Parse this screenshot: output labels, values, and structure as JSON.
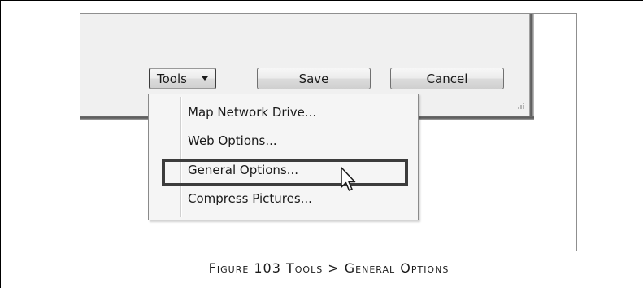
{
  "dialog": {
    "buttons": {
      "tools_label": "Tools",
      "save_label": "Save",
      "cancel_label": "Cancel"
    },
    "icons": {
      "dropdown": "chevron-down-icon",
      "resize": "resize-grip-icon",
      "cursor": "arrow-cursor-icon"
    }
  },
  "tools_menu": {
    "items": [
      {
        "label": "Map Network Drive..."
      },
      {
        "label": "Web Options..."
      },
      {
        "label": "General Options...",
        "highlighted": true
      },
      {
        "label": "Compress Pictures..."
      }
    ],
    "highlight_color": "#3c3c3c"
  },
  "caption": "Figure 103 Tools > General Options"
}
